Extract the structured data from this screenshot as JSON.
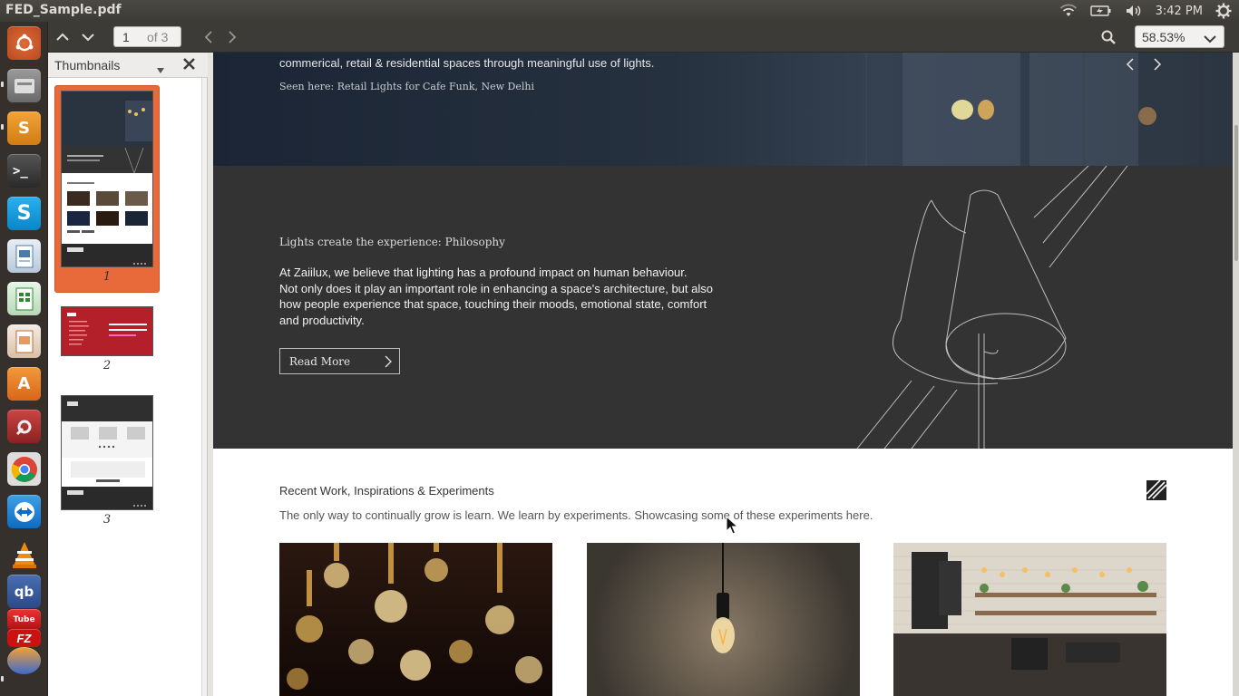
{
  "window": {
    "title": "FED_Sample.pdf"
  },
  "panel": {
    "clock": "3:42 PM",
    "indicators": [
      "wifi-icon",
      "battery-icon",
      "volume-icon",
      "settings-gear-icon"
    ]
  },
  "launcher": {
    "items": [
      "ubuntu-dash",
      "files",
      "sublime-text",
      "terminal",
      "skype",
      "libreoffice-writer",
      "libreoffice-calc",
      "libreoffice-impress",
      "software-center",
      "system-settings",
      "chrome",
      "teamviewer",
      "vlc",
      "qbittorrent",
      "youtube-downloader",
      "filezilla",
      "firefox"
    ]
  },
  "toolbar": {
    "page_current": "1",
    "page_total": "of 3",
    "zoom": "58.53%"
  },
  "sidebar": {
    "title": "Thumbnails",
    "thumbnails": [
      {
        "label": "1",
        "selected": true
      },
      {
        "label": "2",
        "selected": false
      },
      {
        "label": "3",
        "selected": false
      }
    ]
  },
  "document": {
    "hero": {
      "line1": "commerical, retail & residential spaces through meaningful use of lights.",
      "line2": "Seen here: Retail Lights for Cafe Funk, New Delhi"
    },
    "philosophy": {
      "heading": "Lights create the experience: Philosophy",
      "body_lines": [
        "At Zaiilux, we believe that lighting has a profound impact on human behaviour.",
        "Not only does it play an important role in enhancing a space's architecture, but also",
        "how people experience that space, touching their moods, emotional state, comfort",
        "and productivity."
      ],
      "read_more": "Read More"
    },
    "recent": {
      "heading": "Recent Work, Inspirations & Experiments",
      "subtitle": "The only way to continually grow is learn. We learn by experiments. Showcasing some of these experiments here."
    }
  },
  "colors": {
    "accent_selection": "#e8693a",
    "panel": "#3c3b37",
    "philosophy_bg": "#333333"
  }
}
